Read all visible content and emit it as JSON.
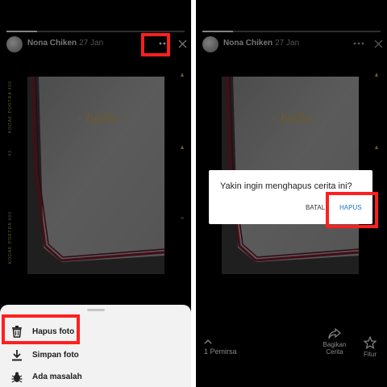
{
  "story": {
    "username": "Nona Chiken",
    "date": "27 Jan",
    "progress_fraction": 0.17,
    "photo_text": "- hello -"
  },
  "film_labels": {
    "left_top": "KODAK PORTRA 400",
    "left_mid": "43",
    "left_bottom": "KODAK PORTRA 400",
    "right_mid": "8"
  },
  "menu": {
    "items": [
      {
        "label": "Hapus foto",
        "icon": "trash-icon"
      },
      {
        "label": "Simpan foto",
        "icon": "download-icon"
      },
      {
        "label": "Ada masalah",
        "icon": "bug-icon"
      }
    ]
  },
  "dialog": {
    "message": "Yakin ingin menghapus cerita ini?",
    "cancel_label": "BATAL",
    "confirm_label": "HAPUS"
  },
  "footer": {
    "viewers_label": "1 Pemirsa",
    "share_label_line1": "Bagikan",
    "share_label_line2": "Cerita",
    "feature_label": "Fitur"
  },
  "colors": {
    "highlight": "#ff1f1f",
    "dialog_confirm": "#1e73d8",
    "background": "#000000",
    "sheet": "#f2f2f2"
  }
}
